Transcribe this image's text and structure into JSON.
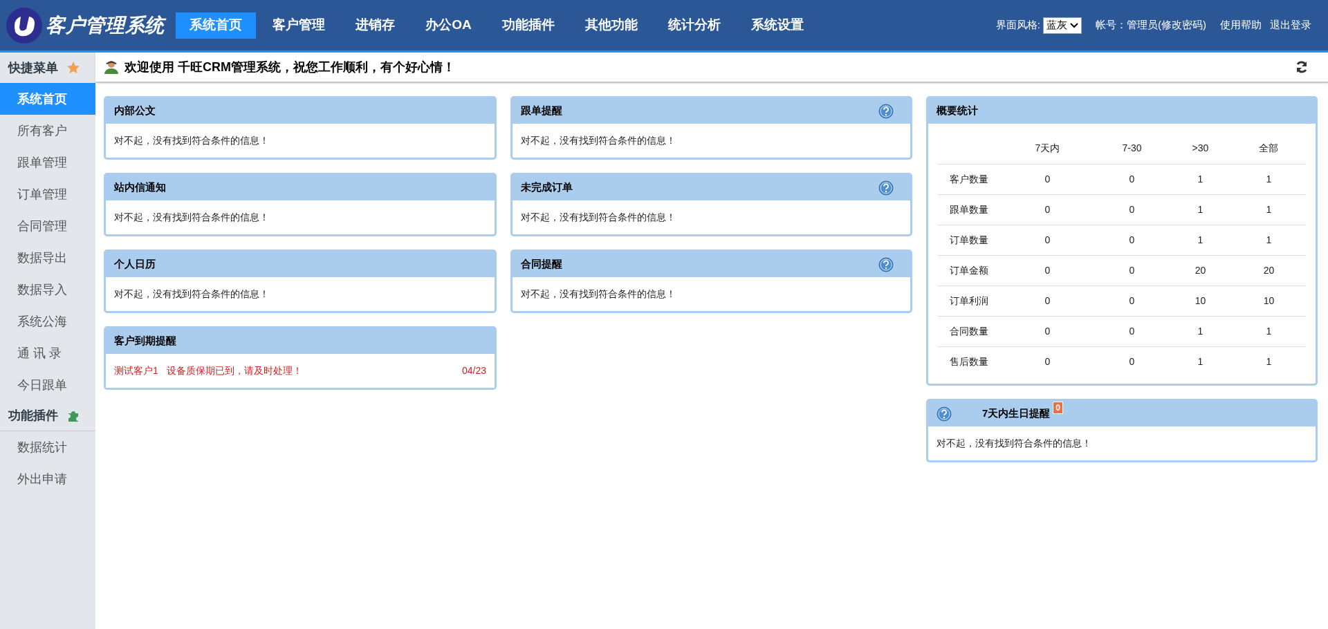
{
  "header": {
    "title": "客户管理系统",
    "nav": [
      {
        "label": "系统首页",
        "selected": true
      },
      {
        "label": "客户管理",
        "selected": false
      },
      {
        "label": "进销存",
        "selected": false
      },
      {
        "label": "办公OA",
        "selected": false
      },
      {
        "label": "功能插件",
        "selected": false
      },
      {
        "label": "其他功能",
        "selected": false
      },
      {
        "label": "统计分析",
        "selected": false
      },
      {
        "label": "系统设置",
        "selected": false
      }
    ],
    "theme_label": "界面风格:",
    "theme_value": "蓝灰",
    "account": "帐号：管理员",
    "change_password": "(修改密码)",
    "links": [
      "使用帮助",
      "退出登录"
    ]
  },
  "sidebar": {
    "sections": [
      {
        "title": "快捷菜单",
        "kind": "star",
        "items": [
          {
            "label": "系统首页",
            "selected": true
          },
          {
            "label": "所有客户",
            "selected": false
          },
          {
            "label": "跟单管理",
            "selected": false
          },
          {
            "label": "订单管理",
            "selected": false
          },
          {
            "label": "合同管理",
            "selected": false
          },
          {
            "label": "数据导出",
            "selected": false
          },
          {
            "label": "数据导入",
            "selected": false
          },
          {
            "label": "系统公海",
            "selected": false
          },
          {
            "label": "通 讯 录",
            "selected": false
          },
          {
            "label": "今日跟单",
            "selected": false
          }
        ]
      },
      {
        "title": "功能插件",
        "kind": "puzzle",
        "items": [
          {
            "label": "数据统计",
            "selected": false
          },
          {
            "label": "外出申请",
            "selected": false
          }
        ]
      }
    ]
  },
  "welcome": "欢迎使用 千旺CRM管理系统，祝您工作顺利，有个好心情！",
  "columns": [
    [
      {
        "title": "内部公文",
        "help": false,
        "kind": "message",
        "message": "对不起，没有找到符合条件的信息！"
      },
      {
        "title": "站内信通知",
        "help": false,
        "kind": "message",
        "message": "对不起，没有找到符合条件的信息！"
      },
      {
        "title": "个人日历",
        "help": false,
        "kind": "message",
        "message": "对不起，没有找到符合条件的信息！"
      },
      {
        "title": "客户到期提醒",
        "help": false,
        "kind": "alerts",
        "alerts": [
          {
            "customer": "测试客户1",
            "text": "设备质保期已到，请及时处理！",
            "date": "04/23"
          }
        ]
      }
    ],
    [
      {
        "title": "跟单提醒",
        "help": true,
        "kind": "message",
        "message": "对不起，没有找到符合条件的信息！"
      },
      {
        "title": "未完成订单",
        "help": true,
        "kind": "message",
        "message": "对不起，没有找到符合条件的信息！"
      },
      {
        "title": "合同提醒",
        "help": true,
        "kind": "message",
        "message": "对不起，没有找到符合条件的信息！"
      }
    ],
    [
      {
        "title": "概要统计",
        "help": false,
        "kind": "stats",
        "table": {
          "columns": [
            "7天内",
            "7-30",
            ">30",
            "全部"
          ],
          "rows": [
            {
              "label": "客户数量",
              "values": [
                "0",
                "0",
                "1",
                "1"
              ]
            },
            {
              "label": "跟单数量",
              "values": [
                "0",
                "0",
                "1",
                "1"
              ]
            },
            {
              "label": "订单数量",
              "values": [
                "0",
                "0",
                "1",
                "1"
              ]
            },
            {
              "label": "订单金额",
              "values": [
                "0",
                "0",
                "20",
                "20"
              ]
            },
            {
              "label": "订单利润",
              "values": [
                "0",
                "0",
                "10",
                "10"
              ]
            },
            {
              "label": "合同数量",
              "values": [
                "0",
                "0",
                "1",
                "1"
              ]
            },
            {
              "label": "售后数量",
              "values": [
                "0",
                "0",
                "1",
                "1"
              ]
            }
          ]
        }
      },
      {
        "title": "7天内生日提醒",
        "help": true,
        "badge": "0",
        "kind": "reminder",
        "message": "对不起，没有找到符合条件的信息！"
      }
    ]
  ]
}
